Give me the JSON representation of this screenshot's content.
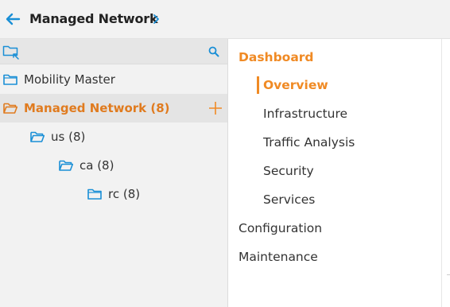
{
  "header": {
    "title": "Managed Network",
    "accent_color": "#1a8fd6"
  },
  "tree": {
    "items": [
      {
        "label": "Mobility Master",
        "icon": "folder-icon"
      },
      {
        "label": "Managed Network (8)",
        "icon": "folder-open-icon",
        "selected": true
      },
      {
        "label": "us (8)",
        "icon": "folder-open-icon"
      },
      {
        "label": "ca (8)",
        "icon": "folder-open-icon"
      },
      {
        "label": "rc (8)",
        "icon": "folder-icon"
      }
    ],
    "selected_color": "#e07b1f"
  },
  "menu": {
    "dashboard": "Dashboard",
    "sub": [
      "Overview",
      "Infrastructure",
      "Traffic Analysis",
      "Security",
      "Services"
    ],
    "active": "Overview",
    "configuration": "Configuration",
    "maintenance": "Maintenance",
    "accent_color": "#f08a24"
  }
}
